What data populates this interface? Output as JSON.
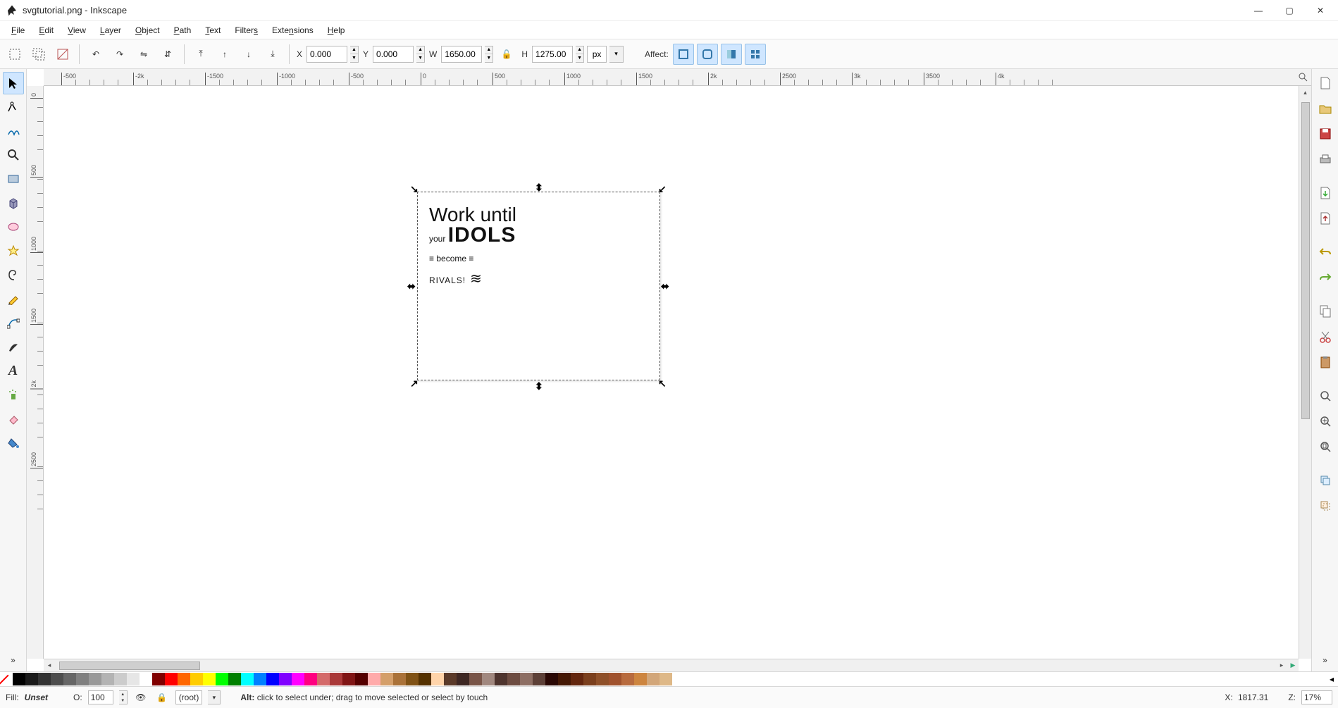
{
  "title": "svgtutorial.png - Inkscape",
  "menu": [
    "File",
    "Edit",
    "View",
    "Layer",
    "Object",
    "Path",
    "Text",
    "Filters",
    "Extensions",
    "Help"
  ],
  "toolopts": {
    "x_label": "X",
    "x": "0.000",
    "y_label": "Y",
    "y": "0.000",
    "w_label": "W",
    "w": "1650.00",
    "h_label": "H",
    "h": "1275.00",
    "unit": "px",
    "affect": "Affect:"
  },
  "canvas_text": {
    "l1": "Work until",
    "l2_a": "your ",
    "l2_b": "IDOLS",
    "l3_pre": "≡ ",
    "l3": "become",
    "l3_post": " ≡",
    "l4": "RIVALS!",
    "l4_post": " ≋"
  },
  "palette_colors": [
    "#000000",
    "#1a1a1a",
    "#333333",
    "#4d4d4d",
    "#666666",
    "#808080",
    "#999999",
    "#b3b3b3",
    "#cccccc",
    "#e6e6e6",
    "#ffffff",
    "#800000",
    "#ff0000",
    "#ff6600",
    "#ffcc00",
    "#ffff00",
    "#00ff00",
    "#008000",
    "#00ffff",
    "#0080ff",
    "#0000ff",
    "#8000ff",
    "#ff00ff",
    "#ff0080",
    "#d46a6a",
    "#aa3939",
    "#801515",
    "#550000",
    "#ffaaaa",
    "#d49f6a",
    "#aa7239",
    "#805215",
    "#553100",
    "#ffd4aa",
    "#5b3a29",
    "#3e2723",
    "#795548",
    "#a1887f",
    "#4e342e",
    "#6d4c41",
    "#8d6e63",
    "#5d4037",
    "#2a0804",
    "#451804",
    "#63260e",
    "#7b3f1d",
    "#8f5029",
    "#a0522d",
    "#b86b3e",
    "#cd853f",
    "#d2a679",
    "#deb887"
  ],
  "hruler_ticks": [
    {
      "pos": 25,
      "label": "-500"
    },
    {
      "pos": 127,
      "label": "-2k"
    },
    {
      "pos": 229,
      "label": "-1500"
    },
    {
      "pos": 331,
      "label": "-1000"
    },
    {
      "pos": 433,
      "label": "-500"
    },
    {
      "pos": 535,
      "label": "0"
    },
    {
      "pos": 637,
      "label": "500"
    },
    {
      "pos": 739,
      "label": "1000"
    },
    {
      "pos": 841,
      "label": "1500"
    },
    {
      "pos": 943,
      "label": "2k"
    },
    {
      "pos": 1045,
      "label": "2500"
    },
    {
      "pos": 1147,
      "label": "3k"
    },
    {
      "pos": 1249,
      "label": "3500"
    },
    {
      "pos": 1351,
      "label": "4k"
    }
  ],
  "vruler_ticks": [
    {
      "pos": 10,
      "label": "0"
    },
    {
      "pos": 112,
      "label": "500"
    },
    {
      "pos": 214,
      "label": "1000"
    },
    {
      "pos": 316,
      "label": "1500"
    },
    {
      "pos": 418,
      "label": "2k"
    },
    {
      "pos": 520,
      "label": "2500"
    }
  ],
  "status": {
    "fill": "Fill:",
    "fill_val": "Unset",
    "opacity_label": "O:",
    "opacity": "100",
    "layer": "(root)",
    "hint_prefix": "Alt:",
    "hint": " click to select under; drag to move selected or select by touch",
    "x_label": "X:",
    "x": "1817.31",
    "z_label": "Z:",
    "zoom": "17%"
  }
}
